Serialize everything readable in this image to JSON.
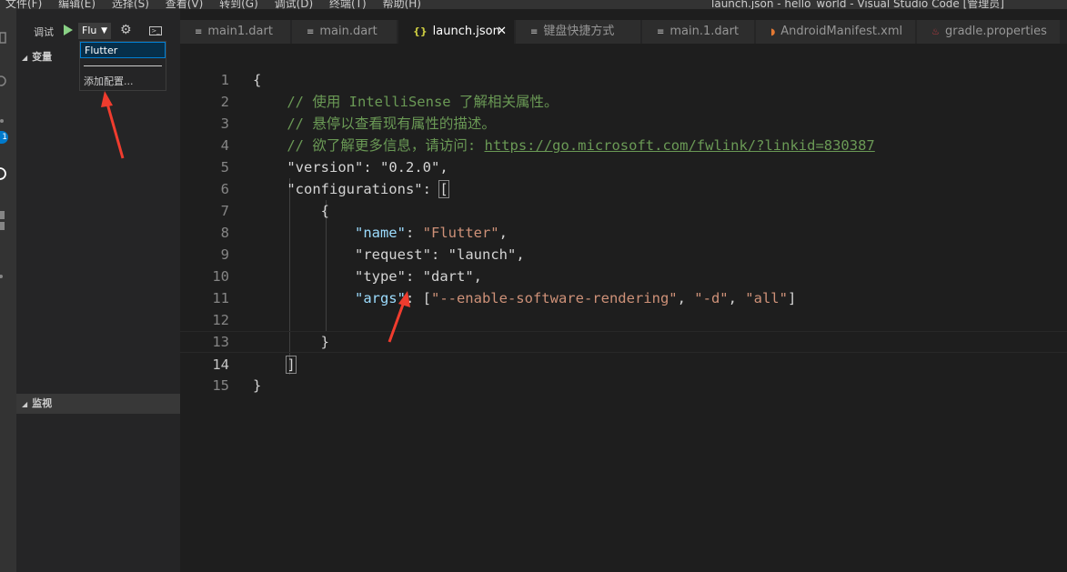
{
  "menu": [
    "文件(F)",
    "编辑(E)",
    "选择(S)",
    "查看(V)",
    "转到(G)",
    "调试(D)",
    "终端(T)",
    "帮助(H)"
  ],
  "window_title": "launch.json - hello_world - Visual Studio Code [管理员]",
  "activity_badge": "1",
  "debug": {
    "label": "调试",
    "config_selected": "Flu",
    "dropdown_options": [
      "Flutter",
      "添加配置..."
    ]
  },
  "panels": {
    "variables": "变量",
    "watch": "监视"
  },
  "tabs": [
    {
      "label": "main1.dart",
      "icon": "lines-icon"
    },
    {
      "label": "main.dart",
      "icon": "lines-icon"
    },
    {
      "label": "launch.json",
      "icon": "json-braces-icon",
      "active": true
    },
    {
      "label": "键盘快捷方式",
      "icon": "lines-icon"
    },
    {
      "label": "main.1.dart",
      "icon": "lines-icon"
    },
    {
      "label": "AndroidManifest.xml",
      "icon": "rss-icon"
    },
    {
      "label": "gradle.properties",
      "icon": "java-icon"
    }
  ],
  "code": {
    "line_numbers": [
      "1",
      "2",
      "3",
      "4",
      "5",
      "6",
      "7",
      "8",
      "9",
      "10",
      "11",
      "12",
      "13",
      "14",
      "15"
    ],
    "current_line": 14,
    "comment1": "// 使用 IntelliSense 了解相关属性。",
    "comment2": "// 悬停以查看现有属性的描述。",
    "comment3_prefix": "// 欲了解更多信息，请访问: ",
    "comment3_link": "https://go.microsoft.com/fwlink/?linkid=830387",
    "version_key": "\"version\"",
    "version_val": "\"0.2.0\"",
    "configurations_key": "\"configurations\"",
    "name_key": "\"name\"",
    "name_val": "\"Flutter\"",
    "request_key": "\"request\"",
    "request_val": "\"launch\"",
    "type_key": "\"type\"",
    "type_val": "\"dart\"",
    "args_key": "\"args\"",
    "args_vals": [
      "\"--enable-software-rendering\"",
      "\"-d\"",
      "\"all\""
    ]
  },
  "colors": {
    "accent": "#007acc",
    "annotation_arrow": "#f03c2e",
    "comment": "#6a9955",
    "string": "#ce9178",
    "key": "#9cdcfe"
  }
}
